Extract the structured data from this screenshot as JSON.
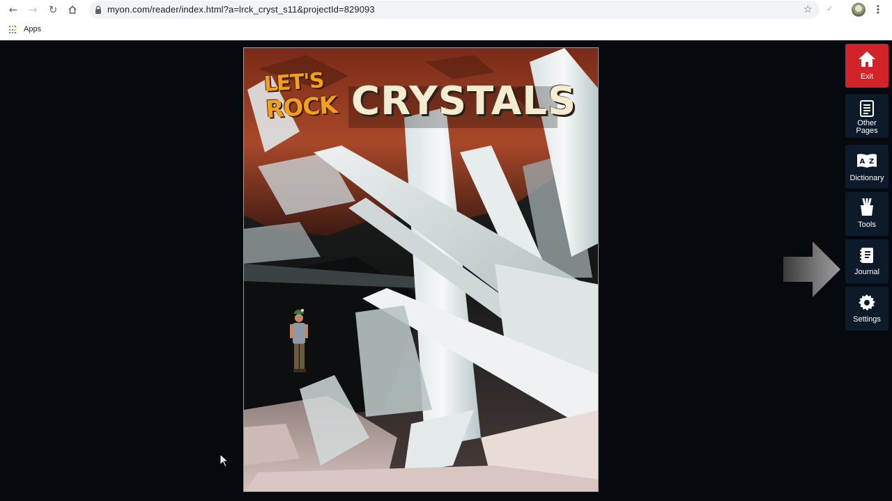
{
  "browser": {
    "url": "myon.com/reader/index.html?a=lrck_cryst_s11&projectId=829093",
    "bookmarks_apps_label": "Apps"
  },
  "book": {
    "series_title_line1": "LET'S",
    "series_title_line2": "ROCK",
    "title": "CRYSTALS"
  },
  "sidebar": {
    "items": [
      {
        "label": "Exit",
        "icon": "home-icon"
      },
      {
        "label_line1": "Other",
        "label_line2": "Pages",
        "icon": "pages-list-icon"
      },
      {
        "label": "Dictionary",
        "icon": "dictionary-az-icon"
      },
      {
        "label": "Tools",
        "icon": "tools-cup-icon"
      },
      {
        "label": "Journal",
        "icon": "journal-icon"
      },
      {
        "label": "Settings",
        "icon": "gear-icon"
      }
    ]
  },
  "colors": {
    "exit_red": "#d2232a",
    "sidebar_button": "#0d1a2a",
    "background": "#06090d",
    "title_cream": "#f4ecd0",
    "series_orange": "#f0a020"
  }
}
